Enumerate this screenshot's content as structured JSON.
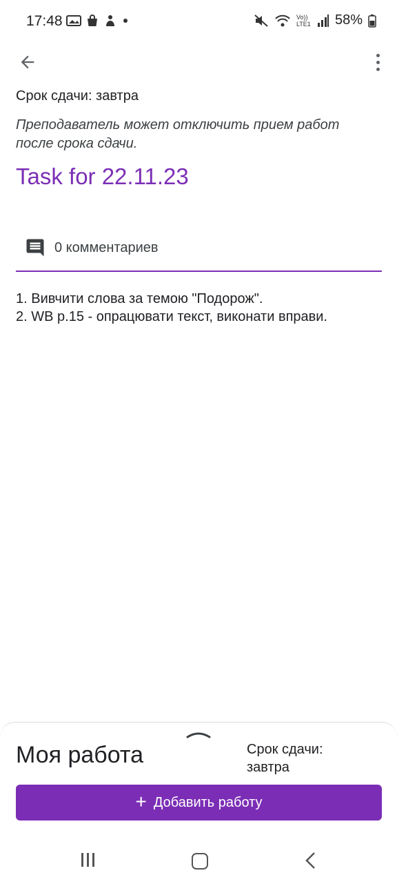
{
  "status_bar": {
    "time": "17:48",
    "left_icons": [
      "gallery-icon",
      "bag-icon",
      "app-icon",
      "dot-icon"
    ],
    "right_icons": [
      "mute-icon",
      "wifi-icon",
      "volte-icon",
      "signal-icon"
    ],
    "volte_label": "Vo)) LTE1",
    "battery_text": "58%"
  },
  "app_bar": {
    "back_icon": "arrow-back-icon",
    "menu_icon": "more-vert-icon"
  },
  "assignment": {
    "due": "Срок сдачи: завтра",
    "note": "Преподаватель может отключить прием работ после срока сдачи.",
    "title": "Task for 22.11.23",
    "comments_label": "0 комментариев",
    "description_lines": [
      "1. Вивчити слова за темою \"Подорож\".",
      "2. WB p.15 - опрацювати текст, виконати вправи."
    ]
  },
  "my_work": {
    "title": "Моя работа",
    "due_label": "Срок сдачи:",
    "due_value": "завтра",
    "add_button_label": "Добавить работу"
  },
  "colors": {
    "accent": "#7b2eb5",
    "text": "#202124",
    "icon": "#5f6368"
  }
}
